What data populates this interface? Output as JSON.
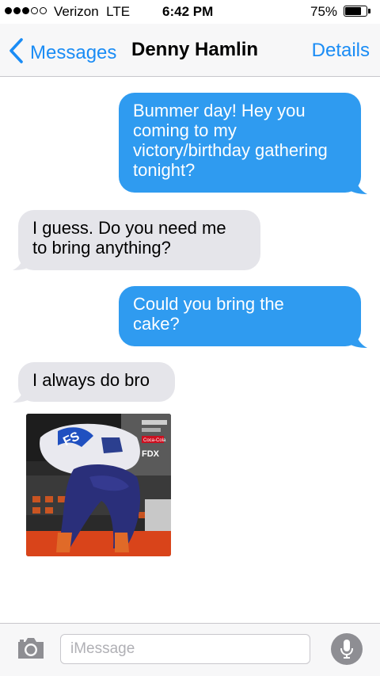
{
  "status_bar": {
    "carrier": "Verizon  LTE",
    "time": "6:42 PM",
    "battery": "75%",
    "signal_icon": "signal-dots-icon",
    "battery_icon": "battery-icon"
  },
  "nav": {
    "back_label": "Messages",
    "title": "Denny Hamlin",
    "details_label": "Details"
  },
  "messages": [
    {
      "direction": "outgoing",
      "lines": [
        "Bummer day! Hey you",
        "coming to my",
        "victory/birthday gathering",
        "tonight?"
      ]
    },
    {
      "direction": "incoming",
      "lines": [
        "I guess. Do you need me",
        "to bring anything?"
      ]
    },
    {
      "direction": "outgoing",
      "lines": [
        "Could you bring the",
        "cake?"
      ]
    },
    {
      "direction": "incoming",
      "lines": [
        "I always do bro"
      ]
    }
  ],
  "photo": {
    "direction": "incoming",
    "visible_text": {
      "fdx": "FDX",
      "coca_cola": "Coca-Cola",
      "number_fragment": "FS"
    }
  },
  "input_bar": {
    "placeholder": "iMessage",
    "value": "",
    "camera_icon": "camera-icon",
    "mic_icon": "microphone-icon"
  },
  "colors": {
    "accent": "#1a8cf5",
    "outgoing_bubble": "#2f9bf0",
    "incoming_bubble": "#e5e5ea"
  }
}
